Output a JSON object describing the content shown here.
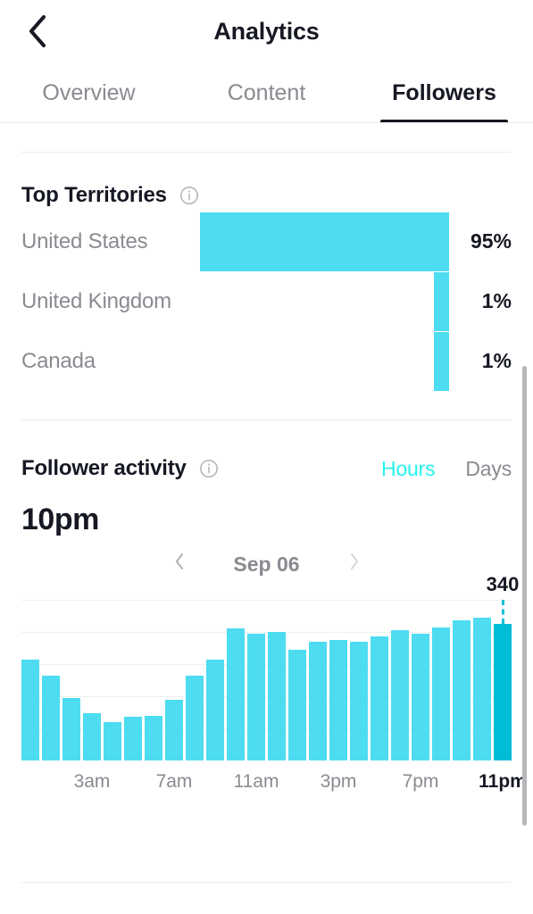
{
  "header": {
    "title": "Analytics",
    "back_icon": "chevron-left-icon"
  },
  "tabs": [
    {
      "label": "Overview",
      "active": false
    },
    {
      "label": "Content",
      "active": false
    },
    {
      "label": "Followers",
      "active": true
    }
  ],
  "territories": {
    "title": "Top Territories",
    "info_icon": "info-circle-icon",
    "rows": [
      {
        "name": "United States",
        "pct_label": "95%",
        "pct": 95
      },
      {
        "name": "United Kingdom",
        "pct_label": "1%",
        "pct": 1
      },
      {
        "name": "Canada",
        "pct_label": "1%",
        "pct": 1
      }
    ]
  },
  "follower_activity": {
    "title": "Follower activity",
    "info_icon": "info-circle-icon",
    "segments": [
      {
        "label": "Hours",
        "active": true
      },
      {
        "label": "Days",
        "active": false
      }
    ],
    "peak_hour": "10pm",
    "date_label": "Sep 06",
    "prev_icon": "chevron-left-small-icon",
    "next_icon": "chevron-right-small-icon",
    "peak_value_label": "340"
  },
  "colors": {
    "accent": "#25f4ee",
    "bar": "#4ddcf0",
    "bar_selected": "#00bdd6",
    "text_primary": "#161823",
    "text_muted": "#8a8b91",
    "gridline": "#efefef",
    "divider": "#ededee"
  },
  "chart_data": {
    "type": "bar",
    "title": "Follower activity",
    "xlabel": "",
    "ylabel": "",
    "grid": true,
    "legend": "none",
    "ylim": [
      0,
      400
    ],
    "gridlines": [
      400,
      320,
      240,
      160,
      80
    ],
    "selected_index": 23,
    "selected_label": "340",
    "categories": [
      "12am",
      "1am",
      "2am",
      "3am",
      "4am",
      "5am",
      "6am",
      "7am",
      "8am",
      "9am",
      "10am",
      "11am",
      "12pm",
      "1pm",
      "2pm",
      "3pm",
      "4pm",
      "5pm",
      "6pm",
      "7pm",
      "8pm",
      "9pm",
      "10pm",
      "11pm"
    ],
    "values": [
      252,
      212,
      156,
      118,
      96,
      108,
      112,
      152,
      212,
      252,
      328,
      316,
      320,
      276,
      296,
      300,
      296,
      308,
      324,
      316,
      332,
      348,
      356,
      340
    ],
    "tick_labels": [
      {
        "category": "3am",
        "label": "3am",
        "bold": false
      },
      {
        "category": "7am",
        "label": "7am",
        "bold": false
      },
      {
        "category": "11am",
        "label": "11am",
        "bold": false
      },
      {
        "category": "3pm",
        "label": "3pm",
        "bold": false
      },
      {
        "category": "7pm",
        "label": "7pm",
        "bold": false
      },
      {
        "category": "11pm",
        "label": "11pm",
        "bold": true
      }
    ]
  }
}
